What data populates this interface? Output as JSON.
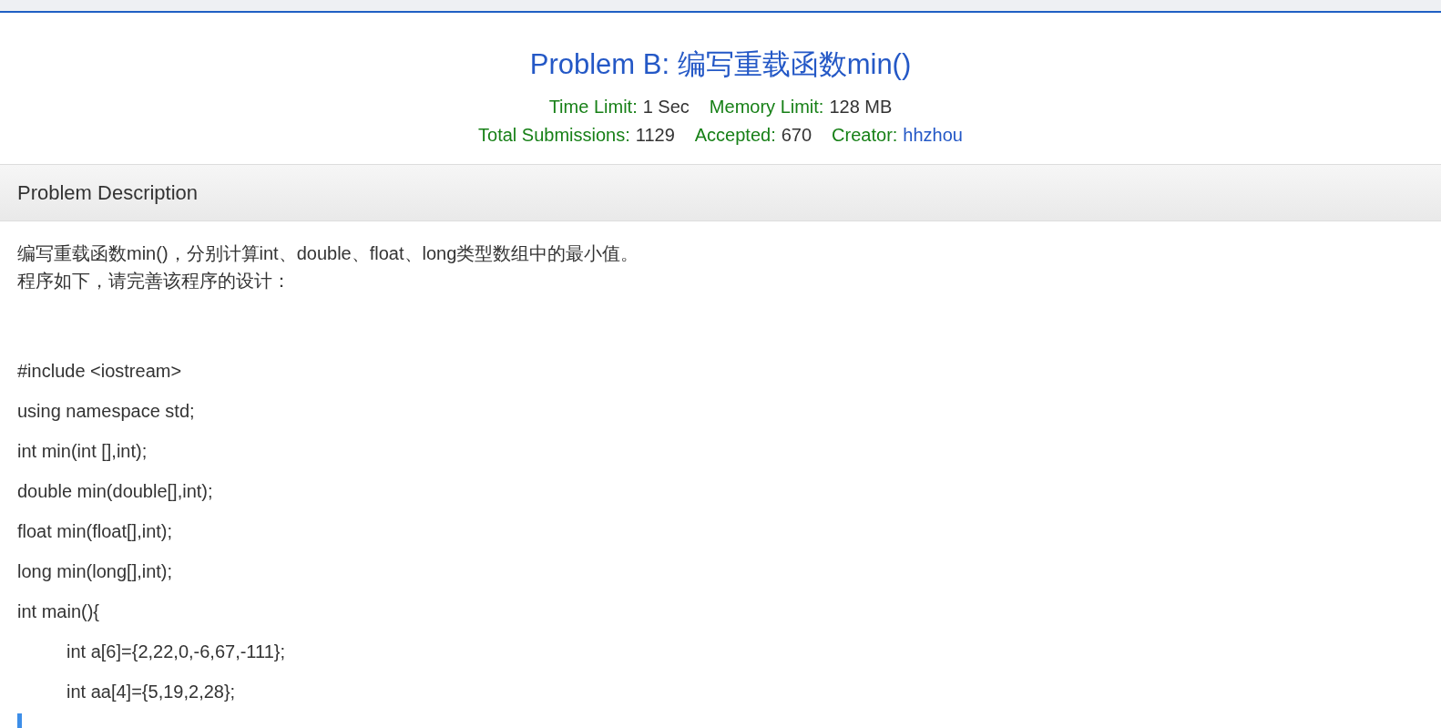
{
  "title": "Problem B: 编写重载函数min()",
  "meta_rows": [
    [
      {
        "label": "Time Limit:",
        "value": "1 Sec",
        "kind": "text"
      },
      {
        "label": "Memory Limit:",
        "value": "128 MB",
        "kind": "text"
      }
    ],
    [
      {
        "label": "Total Submissions:",
        "value": "1129",
        "kind": "text"
      },
      {
        "label": "Accepted:",
        "value": "670",
        "kind": "text"
      },
      {
        "label": "Creator:",
        "value": "hhzhou",
        "kind": "link"
      }
    ]
  ],
  "panel": {
    "heading": "Problem Description",
    "intro": [
      "编写重载函数min()，分别计算int、double、float、long类型数组中的最小值。",
      "程序如下，请完善该程序的设计："
    ],
    "code": [
      {
        "text": "#include <iostream>"
      },
      {
        "text": "using namespace std;"
      },
      {
        "text": "int min(int [],int);"
      },
      {
        "text": "double min(double[],int);"
      },
      {
        "text": "float min(float[],int);"
      },
      {
        "text": "long min(long[],int);"
      },
      {
        "text": "int main(){",
        "children": [
          {
            "text": "int a[6]={2,22,0,-6,67,-111};"
          },
          {
            "text": "int aa[4]={5,19,2,28};"
          }
        ]
      }
    ]
  }
}
